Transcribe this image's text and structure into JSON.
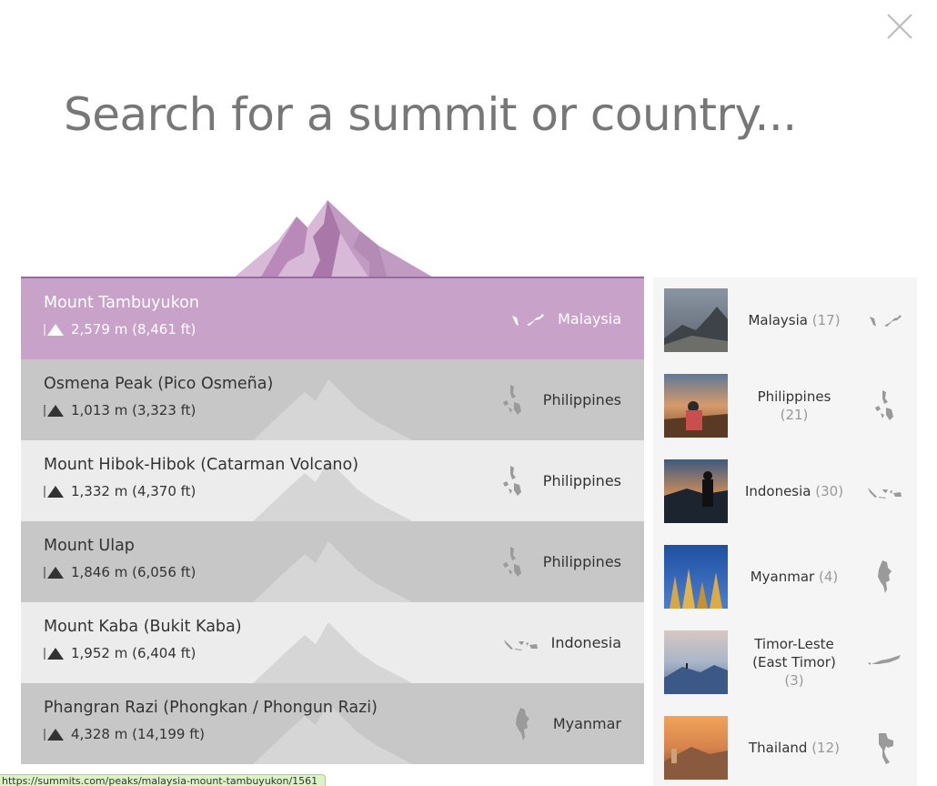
{
  "search": {
    "placeholder": "Search for a summit or country..."
  },
  "results": [
    {
      "name": "Mount Tambuyukon",
      "elevation": "2,579 m (8,461 ft)",
      "country": "Malaysia",
      "map_icon": "malaysia-map-icon",
      "active": true
    },
    {
      "name": "Osmena Peak (Pico Osmeña)",
      "elevation": "1,013 m (3,323 ft)",
      "country": "Philippines",
      "map_icon": "philippines-map-icon"
    },
    {
      "name": "Mount Hibok-Hibok (Catarman Volcano)",
      "elevation": "1,332 m (4,370 ft)",
      "country": "Philippines",
      "map_icon": "philippines-map-icon"
    },
    {
      "name": "Mount Ulap",
      "elevation": "1,846 m (6,056 ft)",
      "country": "Philippines",
      "map_icon": "philippines-map-icon"
    },
    {
      "name": "Mount Kaba (Bukit Kaba)",
      "elevation": "1,952 m (6,404 ft)",
      "country": "Indonesia",
      "map_icon": "indonesia-map-icon"
    },
    {
      "name": "Phangran Razi (Phongkan / Phongun Razi)",
      "elevation": "4,328 m (14,199 ft)",
      "country": "Myanmar",
      "map_icon": "myanmar-map-icon"
    }
  ],
  "countries": [
    {
      "name": "Malaysia",
      "count": "(17)",
      "map_icon": "malaysia-map-icon",
      "thumb": "misty-rocky-summit-photo"
    },
    {
      "name": "Philippines",
      "count": "(21)",
      "map_icon": "philippines-map-icon",
      "thumb": "hiker-sunset-photo"
    },
    {
      "name": "Indonesia",
      "count": "(30)",
      "map_icon": "indonesia-map-icon",
      "thumb": "silhouette-lake-photo"
    },
    {
      "name": "Myanmar",
      "count": "(4)",
      "map_icon": "myanmar-map-icon",
      "thumb": "golden-pagodas-photo"
    },
    {
      "name": "Timor-Leste (East Timor)",
      "count": "(3)",
      "map_icon": "timor-leste-map-icon",
      "thumb": "blue-mountain-ridge-photo"
    },
    {
      "name": "Thailand",
      "count": "(12)",
      "map_icon": "thailand-map-icon",
      "thumb": "orange-sunset-peak-photo"
    }
  ],
  "status_bar": {
    "url": "https://summits.com/peaks/malaysia-mount-tambuyukon/1561"
  },
  "colors": {
    "active_row": "#c9a2c9",
    "odd_row": "#c7c7c7",
    "even_row": "#ececec",
    "accent_line": "#9b6aa0",
    "panel_bg": "#f5f5f5"
  }
}
